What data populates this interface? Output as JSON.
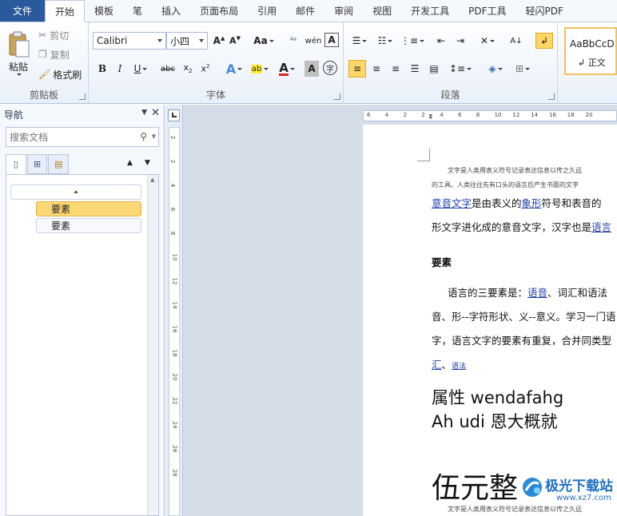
{
  "tabs": [
    "文件",
    "开始",
    "模板",
    "笔",
    "插入",
    "页面布局",
    "引用",
    "邮件",
    "审阅",
    "视图",
    "开发工具",
    "PDF工具",
    "轻闪PDF"
  ],
  "ribbon": {
    "clipboard": {
      "title": "剪贴板",
      "paste": "粘贴",
      "cut": "剪切",
      "copy": "复制",
      "format_painter": "格式刷"
    },
    "font": {
      "title": "字体",
      "font_name": "Calibri",
      "font_size": "小四"
    },
    "paragraph": {
      "title": "段落"
    },
    "styles": {
      "preview": "AaBbCcD",
      "normal": "↲ 正文"
    }
  },
  "nav": {
    "title": "导航",
    "search_placeholder": "搜索文档",
    "headings": [
      "要素",
      "要素"
    ]
  },
  "ruler": {
    "h_ticks": [
      "6",
      "4",
      "2",
      "2",
      "4",
      "6",
      "8",
      "10",
      "12",
      "14",
      "16",
      "18",
      "20"
    ],
    "v_ticks": [
      "2",
      "2",
      "4",
      "6",
      "8",
      "10",
      "12",
      "14",
      "16",
      "18",
      "20",
      "22",
      "24",
      "26",
      "28"
    ]
  },
  "doc": {
    "line1": "文字是人类用表义符号记录表达信息以传之久远",
    "line2": "的工具。人类往往先有口头的语言后产生书面的文字",
    "line3_link": "意音文字",
    "line3_a": "是由表义的",
    "line3_link2": "象形",
    "line3_b": "符号和表音的",
    "line4": "形文字进化成的意音文字，汉字也是",
    "line4_link": "语言",
    "heading": "要素",
    "p2_a": "语言的三要素是：",
    "p2_link": "语音",
    "p2_b": "、词汇和语法",
    "p3": "音、形--字符形状、义--意义。学习一门语",
    "p4": "字，语言文字的要素有重复，合并同类型",
    "p5_link": "汇",
    "p5_link2": "语法",
    "big1": "属性 wendafahg",
    "big2": "Ah udi 恩大概就",
    "big3": "伍元整",
    "bottom": "文字是人类用表义符号记录表达信息以传之久远"
  },
  "watermark": {
    "name": "极光下载站",
    "url": "www.xz7.com"
  }
}
